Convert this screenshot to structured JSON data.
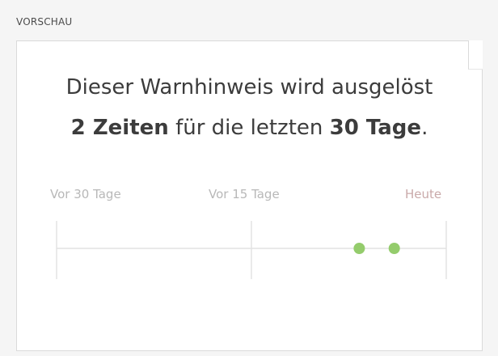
{
  "section": {
    "label": "VORSCHAU"
  },
  "preview": {
    "line1": "Dieser Warnhinweis wird ausgelöst",
    "count": "2 Zeiten",
    "middle": "für die letzten",
    "period": "30 Tage",
    "suffix": ".",
    "axis_labels": {
      "start": "Vor 30 Tage",
      "mid": "Vor 15 Tage",
      "end": "Heute"
    },
    "timeline": {
      "range_days": 30,
      "event_days_ago": [
        6.7,
        4.0
      ],
      "dot_color": "#94cc6c",
      "line_color": "#e2e2e2"
    }
  }
}
